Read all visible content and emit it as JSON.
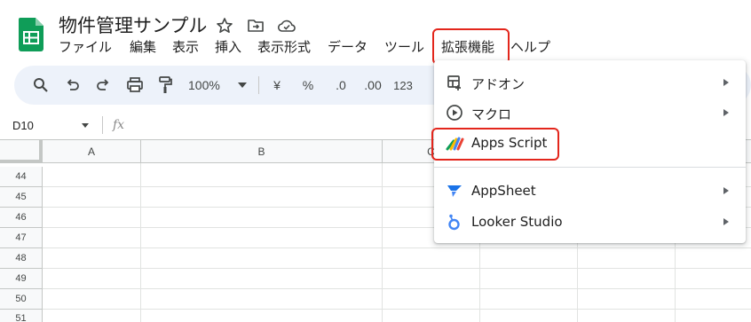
{
  "header": {
    "title": "物件管理サンプル",
    "icons": [
      "star-icon",
      "move-folder-icon",
      "cloud-status-icon"
    ]
  },
  "menu": {
    "items": [
      "ファイル",
      "編集",
      "表示",
      "挿入",
      "表示形式",
      "データ",
      "ツール",
      "拡張機能",
      "ヘルプ"
    ],
    "active": "拡張機能"
  },
  "toolbar": {
    "zoom": "100%",
    "currency": "¥",
    "percent": "%",
    "decrease_decimal": ".0",
    "increase_decimal": ".00",
    "number_format": "123"
  },
  "formula_bar": {
    "cell_ref": "D10",
    "fx": "fx"
  },
  "grid": {
    "columns": [
      "A",
      "B",
      "C"
    ],
    "rows": [
      "44",
      "45",
      "46",
      "47",
      "48",
      "49",
      "50",
      "51"
    ]
  },
  "extensions_menu": {
    "items": [
      {
        "label": "アドオン",
        "icon": "addon-icon",
        "submenu": true
      },
      {
        "label": "マクロ",
        "icon": "play-circle-icon",
        "submenu": true
      },
      {
        "label": "Apps Script",
        "icon": "apps-script-icon",
        "submenu": false
      },
      {
        "label": "AppSheet",
        "icon": "appsheet-icon",
        "submenu": true
      },
      {
        "label": "Looker Studio",
        "icon": "looker-studio-icon",
        "submenu": true
      }
    ]
  },
  "colors": {
    "highlight": "#e3261c",
    "sheets_green": "#0f9d58",
    "toolbar_bg": "#edf2fa"
  }
}
